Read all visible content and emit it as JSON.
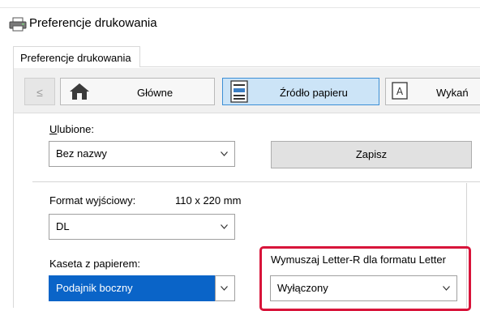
{
  "window": {
    "title": "Preferencje drukowania"
  },
  "tabs": [
    {
      "label": "Preferencje drukowania"
    }
  ],
  "ribbon": {
    "prev_label": "≤",
    "categories": [
      {
        "label": "Główne",
        "icon": "home-icon"
      },
      {
        "label": "Źródło papieru",
        "icon": "paper-tray-icon"
      },
      {
        "label": "Wykań",
        "icon": "finishing-icon"
      }
    ]
  },
  "favorites": {
    "label": "Ulubione:",
    "value": "Bez nazwy"
  },
  "save_button": "Zapisz",
  "output_format": {
    "label": "Format wyjściowy:",
    "size_text": "110 x 220 mm",
    "value": "DL"
  },
  "paper_tray": {
    "label": "Kaseta z papierem:",
    "value": "Podajnik boczny"
  },
  "force_letter": {
    "label": "Wymuszaj Letter-R dla formatu Letter",
    "value": "Wyłączony"
  },
  "colors": {
    "accent": "#0a64c8",
    "selected_category_bg": "#cce4f7",
    "highlight_border": "#d8143a"
  }
}
